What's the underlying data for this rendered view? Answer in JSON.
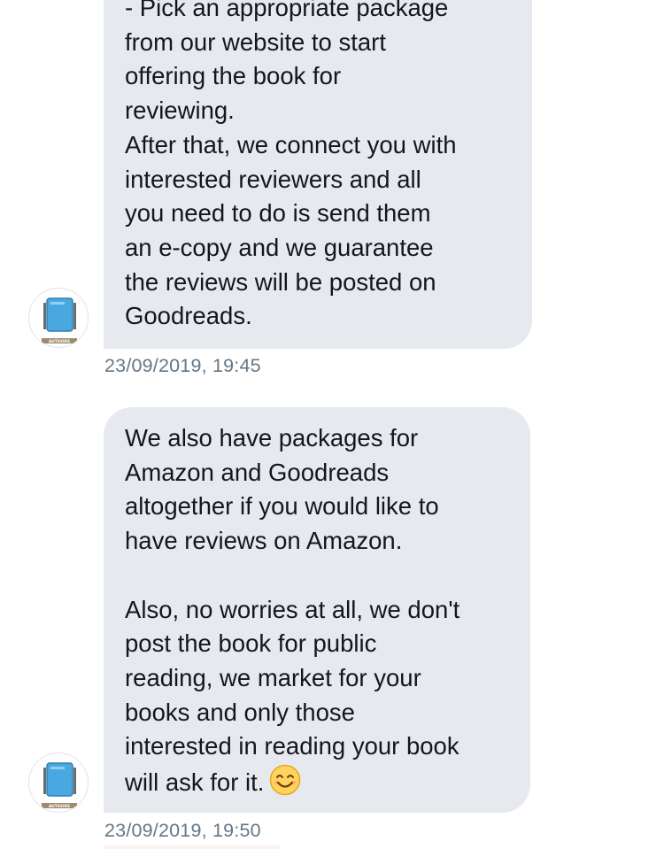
{
  "messages": [
    {
      "text": "- Pick an appropriate package\nfrom our website to start\noffering the book for\nreviewing.\nAfter that, we connect you with\ninterested reviewers and all\nyou need to do is send them\nan e-copy and we guarantee\nthe reviews will be posted on\nGoodreads.",
      "timestamp": "23/09/2019, 19:45",
      "avatar": {
        "icon": "book-logo-icon",
        "label": "AUTHORS"
      }
    },
    {
      "text": "We also have packages for\nAmazon and Goodreads\naltogether if you would like to\nhave reviews on Amazon.\n\nAlso, no worries at all, we don't\npost the book for public\nreading, we market for your\nbooks and only those\ninterested in reading your book\nwill ask for it.",
      "emoji": "smiling-face-icon",
      "timestamp": "23/09/2019, 19:50",
      "avatar": {
        "icon": "book-logo-icon",
        "label": "AUTHORS"
      }
    }
  ],
  "colors": {
    "bubble": "#e6e9ee",
    "text": "#14171a",
    "timestamp": "#657786",
    "book_blue": "#4aa8e0",
    "label_brown": "#a08a6e"
  }
}
